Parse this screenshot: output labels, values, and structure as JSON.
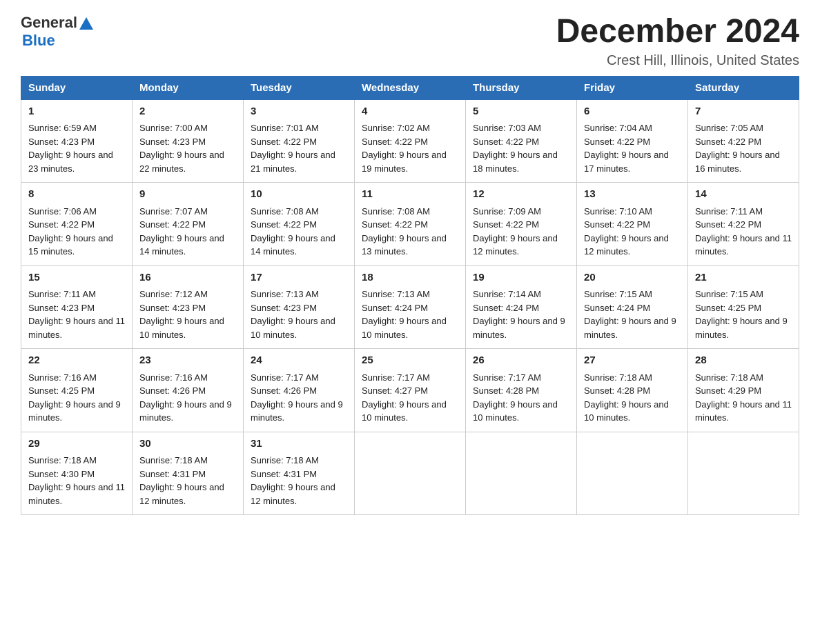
{
  "logo": {
    "general": "General",
    "triangle": "▲",
    "blue": "Blue"
  },
  "title": "December 2024",
  "subtitle": "Crest Hill, Illinois, United States",
  "weekdays": [
    "Sunday",
    "Monday",
    "Tuesday",
    "Wednesday",
    "Thursday",
    "Friday",
    "Saturday"
  ],
  "weeks": [
    [
      {
        "day": "1",
        "sunrise": "Sunrise: 6:59 AM",
        "sunset": "Sunset: 4:23 PM",
        "daylight": "Daylight: 9 hours and 23 minutes."
      },
      {
        "day": "2",
        "sunrise": "Sunrise: 7:00 AM",
        "sunset": "Sunset: 4:23 PM",
        "daylight": "Daylight: 9 hours and 22 minutes."
      },
      {
        "day": "3",
        "sunrise": "Sunrise: 7:01 AM",
        "sunset": "Sunset: 4:22 PM",
        "daylight": "Daylight: 9 hours and 21 minutes."
      },
      {
        "day": "4",
        "sunrise": "Sunrise: 7:02 AM",
        "sunset": "Sunset: 4:22 PM",
        "daylight": "Daylight: 9 hours and 19 minutes."
      },
      {
        "day": "5",
        "sunrise": "Sunrise: 7:03 AM",
        "sunset": "Sunset: 4:22 PM",
        "daylight": "Daylight: 9 hours and 18 minutes."
      },
      {
        "day": "6",
        "sunrise": "Sunrise: 7:04 AM",
        "sunset": "Sunset: 4:22 PM",
        "daylight": "Daylight: 9 hours and 17 minutes."
      },
      {
        "day": "7",
        "sunrise": "Sunrise: 7:05 AM",
        "sunset": "Sunset: 4:22 PM",
        "daylight": "Daylight: 9 hours and 16 minutes."
      }
    ],
    [
      {
        "day": "8",
        "sunrise": "Sunrise: 7:06 AM",
        "sunset": "Sunset: 4:22 PM",
        "daylight": "Daylight: 9 hours and 15 minutes."
      },
      {
        "day": "9",
        "sunrise": "Sunrise: 7:07 AM",
        "sunset": "Sunset: 4:22 PM",
        "daylight": "Daylight: 9 hours and 14 minutes."
      },
      {
        "day": "10",
        "sunrise": "Sunrise: 7:08 AM",
        "sunset": "Sunset: 4:22 PM",
        "daylight": "Daylight: 9 hours and 14 minutes."
      },
      {
        "day": "11",
        "sunrise": "Sunrise: 7:08 AM",
        "sunset": "Sunset: 4:22 PM",
        "daylight": "Daylight: 9 hours and 13 minutes."
      },
      {
        "day": "12",
        "sunrise": "Sunrise: 7:09 AM",
        "sunset": "Sunset: 4:22 PM",
        "daylight": "Daylight: 9 hours and 12 minutes."
      },
      {
        "day": "13",
        "sunrise": "Sunrise: 7:10 AM",
        "sunset": "Sunset: 4:22 PM",
        "daylight": "Daylight: 9 hours and 12 minutes."
      },
      {
        "day": "14",
        "sunrise": "Sunrise: 7:11 AM",
        "sunset": "Sunset: 4:22 PM",
        "daylight": "Daylight: 9 hours and 11 minutes."
      }
    ],
    [
      {
        "day": "15",
        "sunrise": "Sunrise: 7:11 AM",
        "sunset": "Sunset: 4:23 PM",
        "daylight": "Daylight: 9 hours and 11 minutes."
      },
      {
        "day": "16",
        "sunrise": "Sunrise: 7:12 AM",
        "sunset": "Sunset: 4:23 PM",
        "daylight": "Daylight: 9 hours and 10 minutes."
      },
      {
        "day": "17",
        "sunrise": "Sunrise: 7:13 AM",
        "sunset": "Sunset: 4:23 PM",
        "daylight": "Daylight: 9 hours and 10 minutes."
      },
      {
        "day": "18",
        "sunrise": "Sunrise: 7:13 AM",
        "sunset": "Sunset: 4:24 PM",
        "daylight": "Daylight: 9 hours and 10 minutes."
      },
      {
        "day": "19",
        "sunrise": "Sunrise: 7:14 AM",
        "sunset": "Sunset: 4:24 PM",
        "daylight": "Daylight: 9 hours and 9 minutes."
      },
      {
        "day": "20",
        "sunrise": "Sunrise: 7:15 AM",
        "sunset": "Sunset: 4:24 PM",
        "daylight": "Daylight: 9 hours and 9 minutes."
      },
      {
        "day": "21",
        "sunrise": "Sunrise: 7:15 AM",
        "sunset": "Sunset: 4:25 PM",
        "daylight": "Daylight: 9 hours and 9 minutes."
      }
    ],
    [
      {
        "day": "22",
        "sunrise": "Sunrise: 7:16 AM",
        "sunset": "Sunset: 4:25 PM",
        "daylight": "Daylight: 9 hours and 9 minutes."
      },
      {
        "day": "23",
        "sunrise": "Sunrise: 7:16 AM",
        "sunset": "Sunset: 4:26 PM",
        "daylight": "Daylight: 9 hours and 9 minutes."
      },
      {
        "day": "24",
        "sunrise": "Sunrise: 7:17 AM",
        "sunset": "Sunset: 4:26 PM",
        "daylight": "Daylight: 9 hours and 9 minutes."
      },
      {
        "day": "25",
        "sunrise": "Sunrise: 7:17 AM",
        "sunset": "Sunset: 4:27 PM",
        "daylight": "Daylight: 9 hours and 10 minutes."
      },
      {
        "day": "26",
        "sunrise": "Sunrise: 7:17 AM",
        "sunset": "Sunset: 4:28 PM",
        "daylight": "Daylight: 9 hours and 10 minutes."
      },
      {
        "day": "27",
        "sunrise": "Sunrise: 7:18 AM",
        "sunset": "Sunset: 4:28 PM",
        "daylight": "Daylight: 9 hours and 10 minutes."
      },
      {
        "day": "28",
        "sunrise": "Sunrise: 7:18 AM",
        "sunset": "Sunset: 4:29 PM",
        "daylight": "Daylight: 9 hours and 11 minutes."
      }
    ],
    [
      {
        "day": "29",
        "sunrise": "Sunrise: 7:18 AM",
        "sunset": "Sunset: 4:30 PM",
        "daylight": "Daylight: 9 hours and 11 minutes."
      },
      {
        "day": "30",
        "sunrise": "Sunrise: 7:18 AM",
        "sunset": "Sunset: 4:31 PM",
        "daylight": "Daylight: 9 hours and 12 minutes."
      },
      {
        "day": "31",
        "sunrise": "Sunrise: 7:18 AM",
        "sunset": "Sunset: 4:31 PM",
        "daylight": "Daylight: 9 hours and 12 minutes."
      },
      null,
      null,
      null,
      null
    ]
  ]
}
